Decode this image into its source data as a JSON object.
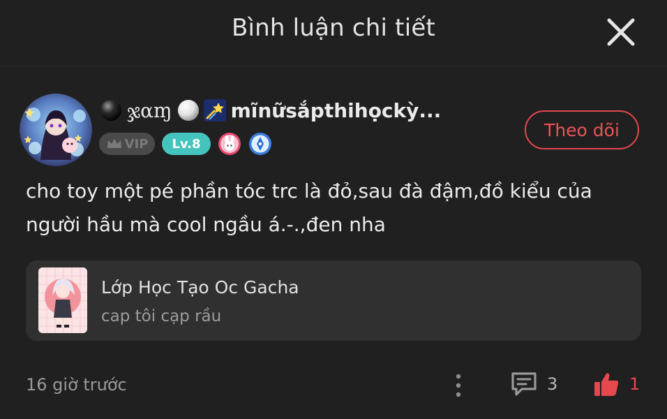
{
  "header": {
    "title": "Bình luận chi tiết"
  },
  "comment": {
    "user": {
      "name_script": "ჯαɱ",
      "name_text": "mĩnữsắpthihọckỳ...",
      "vip_label": "VIP",
      "level_label": "Lv.8"
    },
    "follow_label": "Theo dõi",
    "text": "cho toy một pé phần tóc trc là đỏ,sau đà đậm,đồ kiểu của người hầu mà cool ngầu á.-.,đen nha",
    "linked_post": {
      "title": "Lớp Học Tạo Oc Gacha",
      "subtitle": "cap tôi cạp rầu"
    },
    "timestamp": "16 giờ trước",
    "reply_count": "3",
    "like_count": "1"
  },
  "icons": {
    "close": "close-icon",
    "crown": "crown-icon",
    "more": "more-vertical-icon",
    "reply": "comment-icon",
    "like": "thumbs-up-icon"
  },
  "colors": {
    "background": "#202020",
    "accent_red": "#e5484d",
    "level_teal": "#45c4bd",
    "card_bg": "#303030"
  }
}
